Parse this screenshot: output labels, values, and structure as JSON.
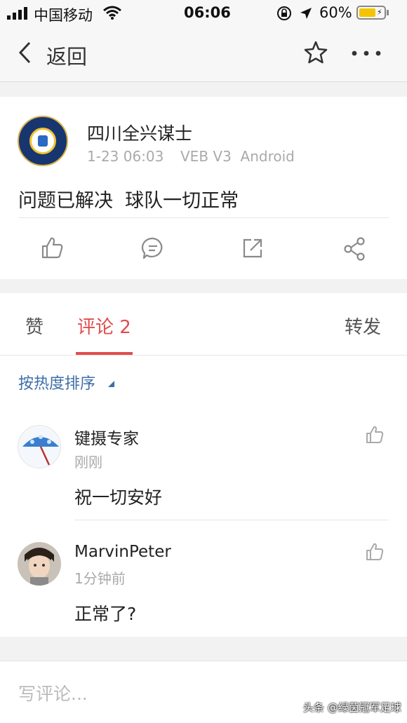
{
  "status": {
    "carrier": "中国移动",
    "time": "06:06",
    "battery": "60%"
  },
  "nav": {
    "back_label": "返回"
  },
  "post": {
    "author": "四川全兴谋士",
    "time": "1-23 06:03",
    "device": "VEB V3  Android",
    "text": "问题已解决  球队一切正常"
  },
  "tabs": {
    "likes": "赞",
    "comments": "评论 2",
    "reposts": "转发"
  },
  "sort_label": "按热度排序",
  "comments": [
    {
      "author": "键摄专家",
      "time": "刚刚",
      "text": "祝一切安好"
    },
    {
      "author": "MarvinPeter",
      "time": "1分钟前",
      "text": "正常了?"
    }
  ],
  "input_placeholder": "写评论...",
  "watermark": "头条 @绿茵冠军足球",
  "colors": {
    "accent": "#e34b4b",
    "link": "#3d6ea8",
    "battery": "#f5c400"
  }
}
